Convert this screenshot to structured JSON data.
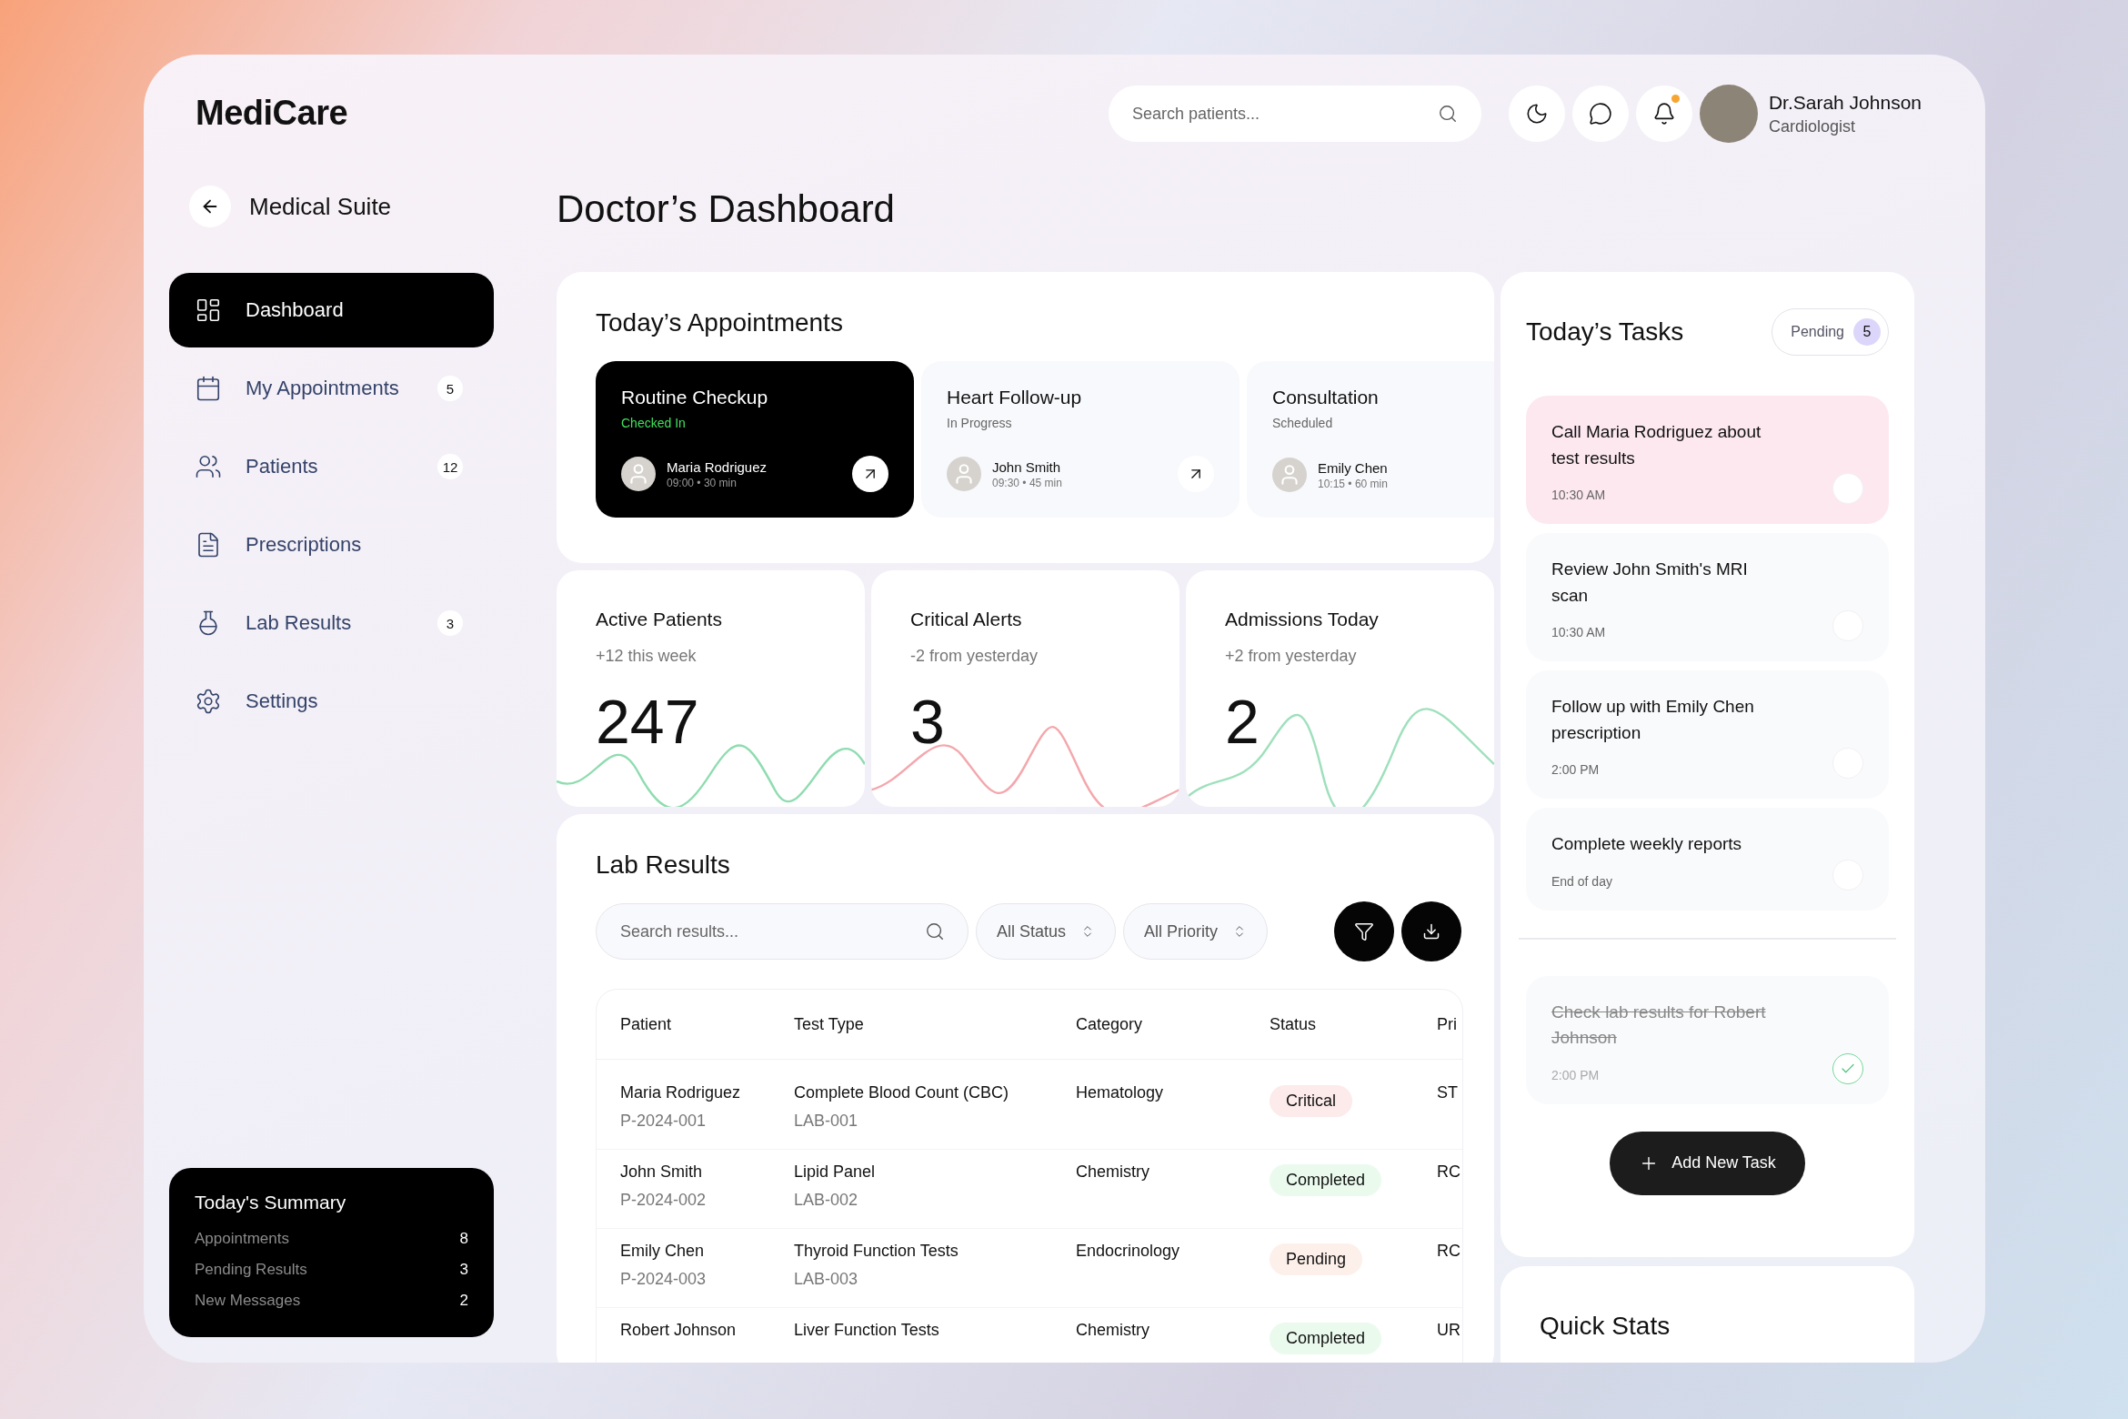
{
  "app": {
    "logo": "MediCare"
  },
  "header": {
    "search": {
      "placeholder": "Search patients..."
    },
    "notifications_unread": true,
    "user": {
      "name": "Dr.Sarah Johnson",
      "role": "Cardiologist"
    }
  },
  "sidebar": {
    "back_label": "Medical Suite",
    "items": [
      {
        "label": "Dashboard",
        "selected": true
      },
      {
        "label": "My Appointments",
        "badge": "5",
        "selected": false
      },
      {
        "label": "Patients",
        "badge": "12",
        "selected": false
      },
      {
        "label": "Prescriptions",
        "selected": false
      },
      {
        "label": "Lab Results",
        "badge": "3",
        "selected": false
      },
      {
        "label": "Settings",
        "selected": false
      }
    ],
    "summary": {
      "title": "Today's Summary",
      "rows": [
        {
          "label": "Appointments",
          "value": "8"
        },
        {
          "label": "Pending Results",
          "value": "3"
        },
        {
          "label": "New Messages",
          "value": "2"
        }
      ]
    }
  },
  "page": {
    "title": "Doctor’s Dashboard"
  },
  "appointments": {
    "title": "Today’s Appointments",
    "items": [
      {
        "title": "Routine Checkup",
        "status": "Checked In",
        "patient": "Maria Rodriguez",
        "time": "09:00 • 30 min",
        "selected": true,
        "action": true
      },
      {
        "title": "Heart Follow-up",
        "status": "In Progress",
        "patient": "John Smith",
        "time": "09:30 • 45 min",
        "selected": false,
        "action": true
      },
      {
        "title": "Consultation",
        "status": "Scheduled",
        "patient": "Emily Chen",
        "time": "10:15 • 60 min",
        "selected": false,
        "action": false
      }
    ]
  },
  "stats": [
    {
      "title": "Active Patients",
      "change": "+12 this week",
      "value": "247",
      "color": "#8fdcb0"
    },
    {
      "title": "Critical Alerts",
      "change": "-2 from yesterday",
      "value": "3",
      "color": "#f4a7ac"
    },
    {
      "title": "Admissions Today",
      "change": "+2 from yesterday",
      "value": "2",
      "color": "#9fe0bc"
    }
  ],
  "lab_results": {
    "title": "Lab Results",
    "search": {
      "placeholder": "Search results..."
    },
    "filters": [
      "All Status",
      "All Priority"
    ],
    "columns": [
      "Patient",
      "Test Type",
      "Category",
      "Status",
      "Pri"
    ],
    "rows": [
      {
        "patient": "Maria Rodriguez",
        "patient_id": "P-2024-001",
        "test": "Complete Blood Count (CBC)",
        "test_id": "LAB-001",
        "category": "Hematology",
        "status": "Critical",
        "kind": "critical",
        "priority": "ST"
      },
      {
        "patient": "John Smith",
        "patient_id": "P-2024-002",
        "test": "Lipid Panel",
        "test_id": "LAB-002",
        "category": "Chemistry",
        "status": "Completed",
        "kind": "completed",
        "priority": "RC"
      },
      {
        "patient": "Emily Chen",
        "patient_id": "P-2024-003",
        "test": "Thyroid Function Tests",
        "test_id": "LAB-003",
        "category": "Endocrinology",
        "status": "Pending",
        "kind": "pending",
        "priority": "RC"
      },
      {
        "patient": "Robert Johnson",
        "test": "Liver Function Tests",
        "category": "Chemistry",
        "status": "Completed",
        "kind": "completed",
        "priority": "UR"
      }
    ]
  },
  "tasks": {
    "title": "Today’s Tasks",
    "badge_label": "Pending",
    "badge_count": "5",
    "items": [
      {
        "text": "Call Maria Rodriguez about test results",
        "time": "10:30 AM",
        "highlighted": true,
        "done": false
      },
      {
        "text": "Review John Smith's MRI scan",
        "time": "10:30 AM",
        "highlighted": false,
        "done": false
      },
      {
        "text": "Follow up with Emily Chen prescription",
        "time": "2:00 PM",
        "highlighted": false,
        "done": false
      },
      {
        "text": "Complete weekly reports",
        "time": "End of day",
        "highlighted": false,
        "done": false
      },
      {
        "text": "Check lab results for Robert Johnson",
        "time": "2:00 PM",
        "highlighted": false,
        "done": true
      }
    ],
    "add_button": "Add New Task"
  },
  "quick_stats": {
    "title": "Quick Stats"
  }
}
